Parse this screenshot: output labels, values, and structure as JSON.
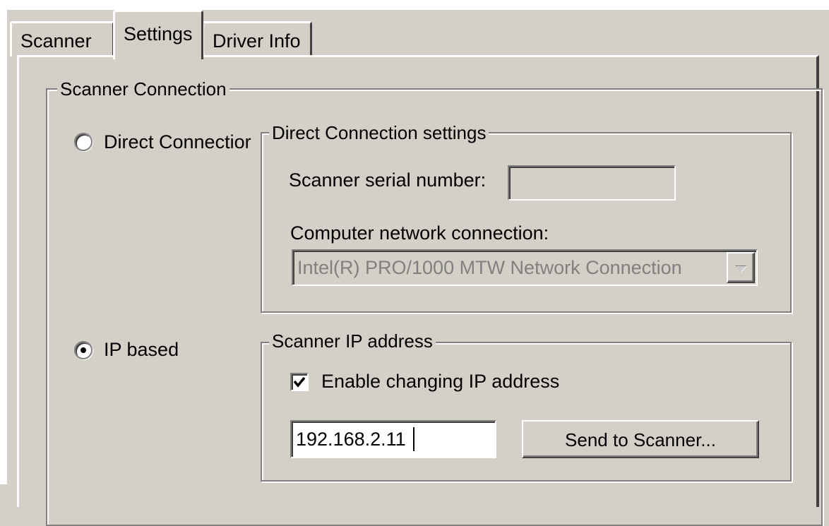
{
  "tabs": [
    {
      "label": "Scanner"
    },
    {
      "label": "Settings"
    },
    {
      "label": "Driver Info"
    }
  ],
  "active_tab": "Settings",
  "scanner_connection": {
    "title": "Scanner Connection",
    "direct": {
      "radio_label": "Direct  Connectior",
      "selected": false,
      "group_title": "Direct Connection settings",
      "serial_label": "Scanner serial number:",
      "serial_value": "",
      "network_label": "Computer network connection:",
      "network_value": "Intel(R) PRO/1000 MTW Network Connection"
    },
    "ip": {
      "radio_label": "IP based",
      "selected": true,
      "group_title": "Scanner IP address",
      "enable_label": "Enable changing IP address",
      "enable_checked": true,
      "ip_value": "192.168.2.11",
      "send_button": "Send to Scanner..."
    }
  }
}
